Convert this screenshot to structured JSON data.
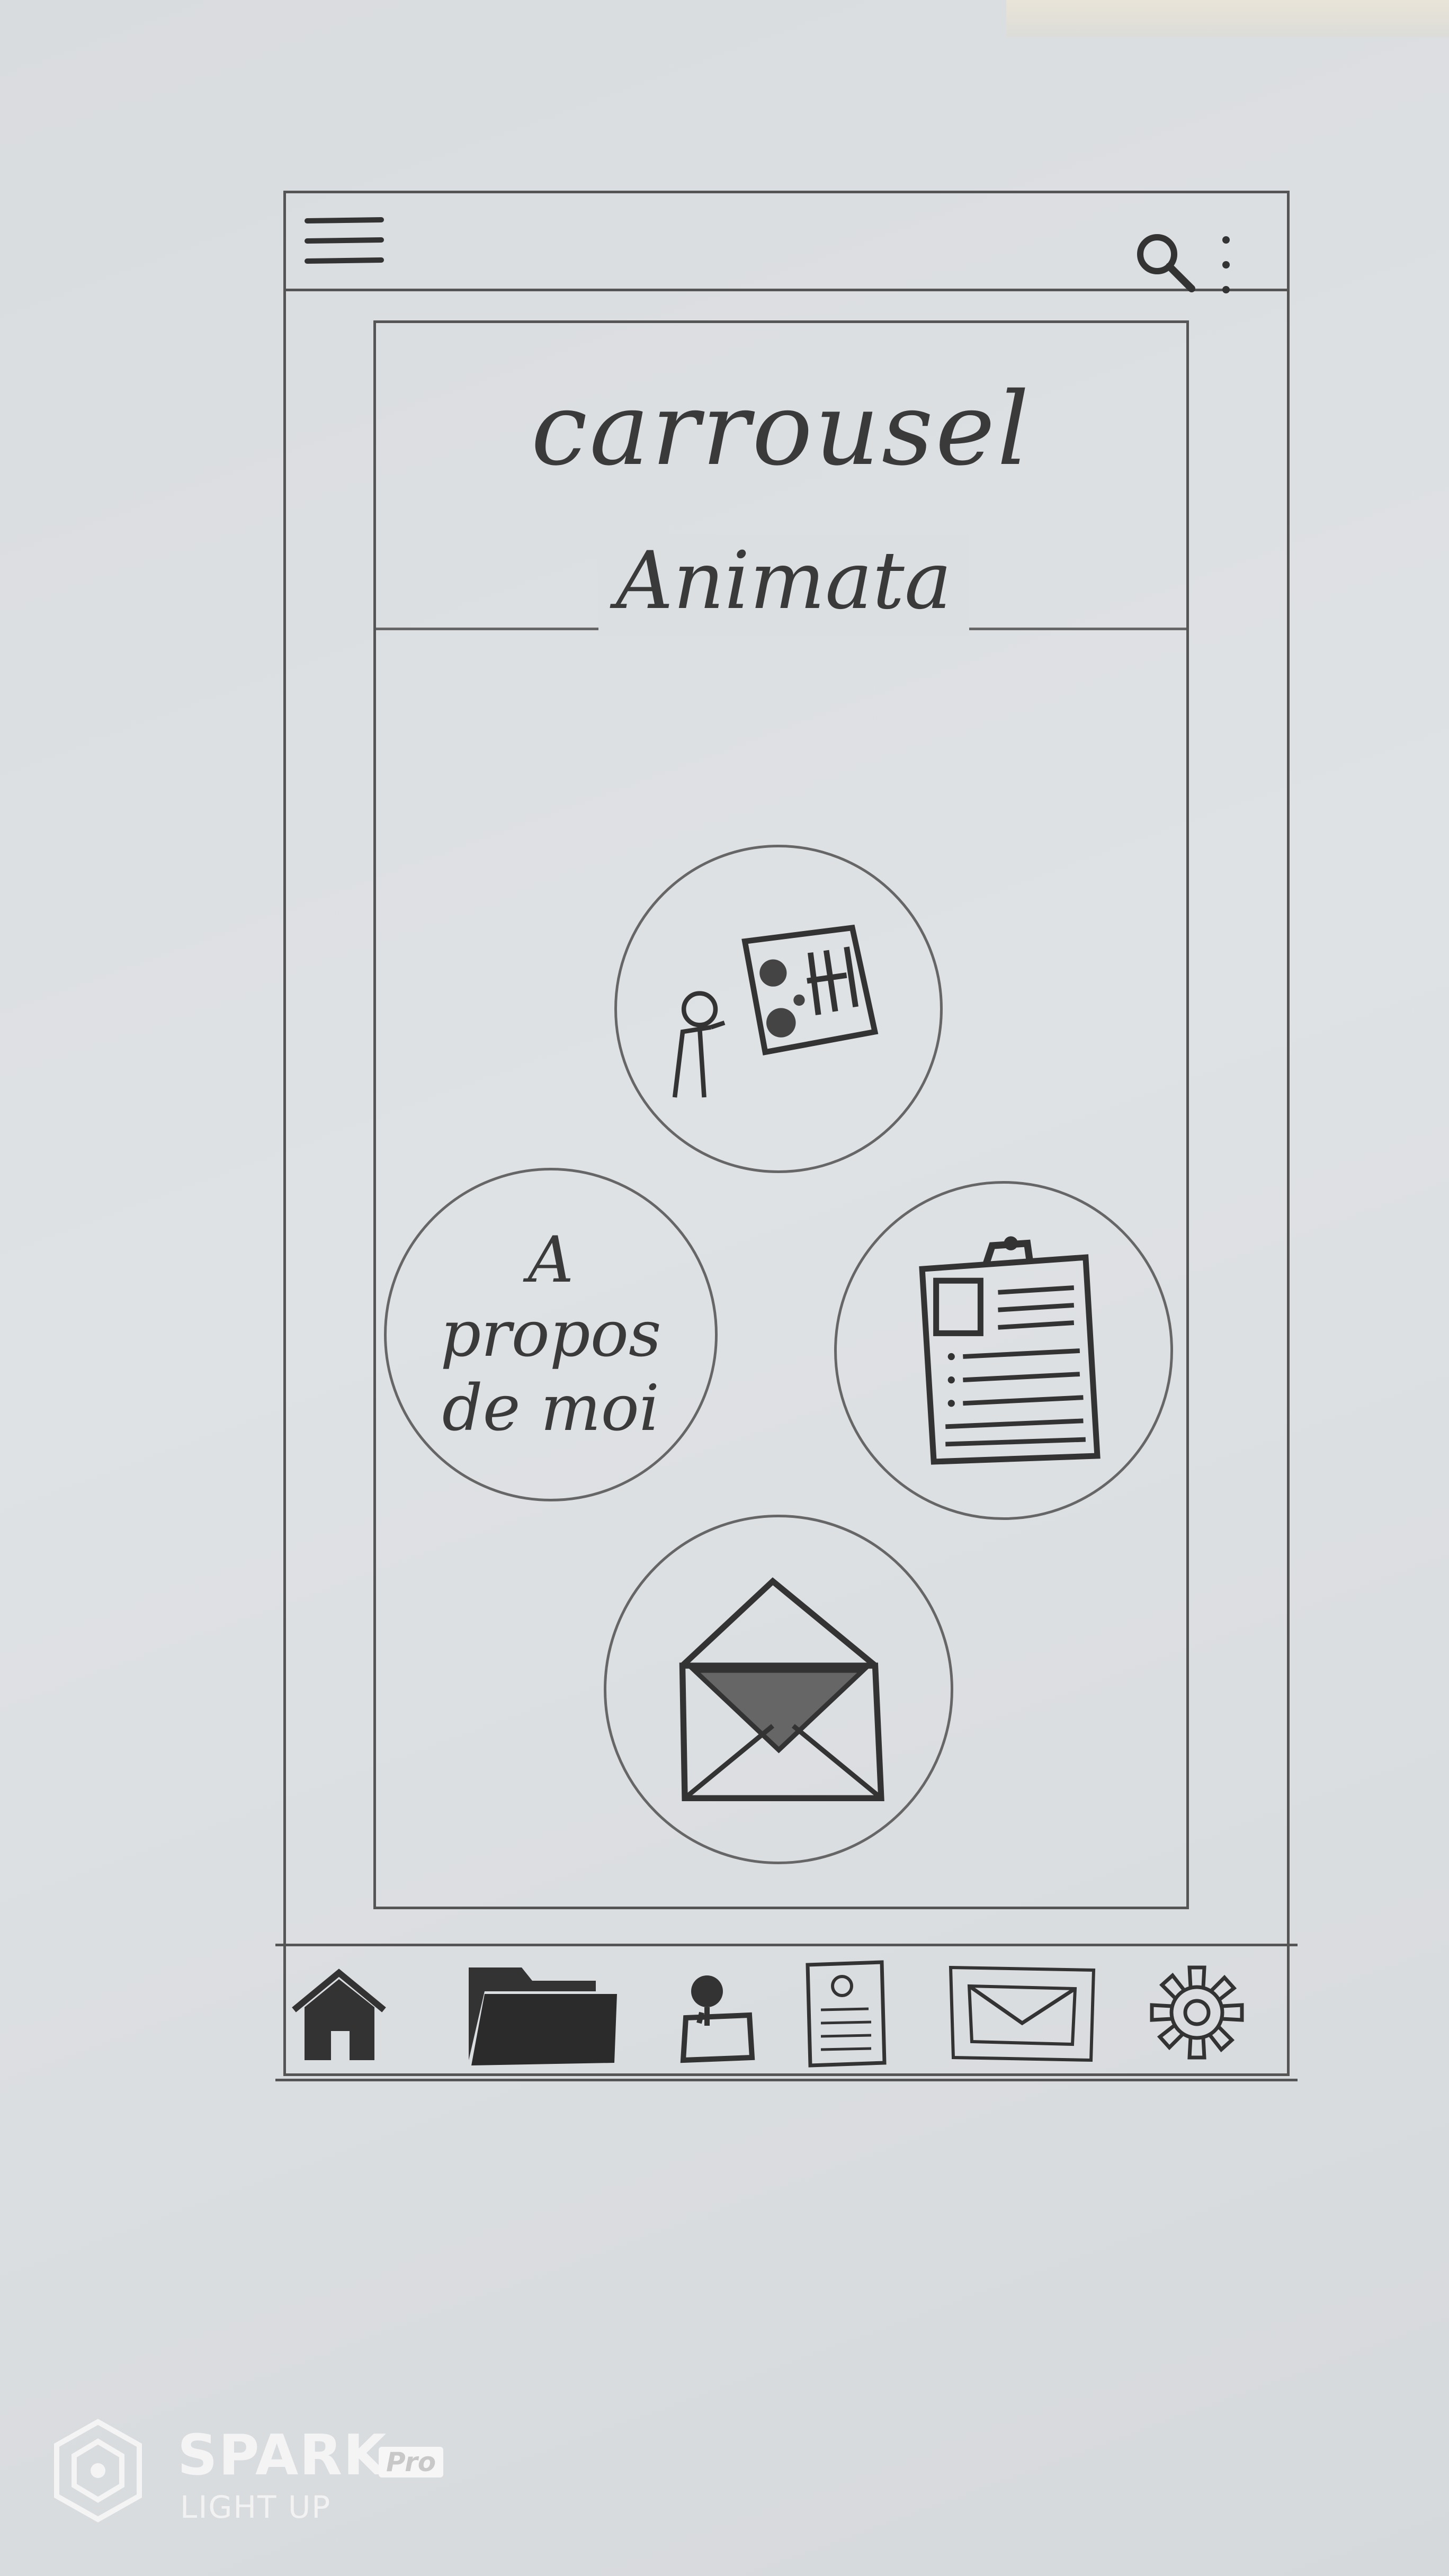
{
  "header": {
    "menu_icon": "hamburger-menu-icon",
    "search_icon": "search-icon",
    "more_icon": "more-vertical-icon"
  },
  "content": {
    "title": "carrousel",
    "section_label": "Animata",
    "circles": [
      {
        "id": "animata",
        "icon": "presentation-board-icon"
      },
      {
        "id": "about",
        "text": "A\npropos\nde moi"
      },
      {
        "id": "cv",
        "icon": "clipboard-resume-icon"
      },
      {
        "id": "contact",
        "icon": "open-envelope-icon"
      }
    ]
  },
  "bottom_nav": [
    {
      "id": "home",
      "icon": "home-icon"
    },
    {
      "id": "folder",
      "icon": "folder-icon"
    },
    {
      "id": "profile",
      "icon": "profile-icon"
    },
    {
      "id": "cv",
      "icon": "document-icon"
    },
    {
      "id": "mail",
      "icon": "mail-icon"
    },
    {
      "id": "settings",
      "icon": "gear-icon"
    }
  ],
  "watermark": {
    "brand": "SPARK",
    "edition": "Pro",
    "tagline": "LIGHT UP"
  }
}
